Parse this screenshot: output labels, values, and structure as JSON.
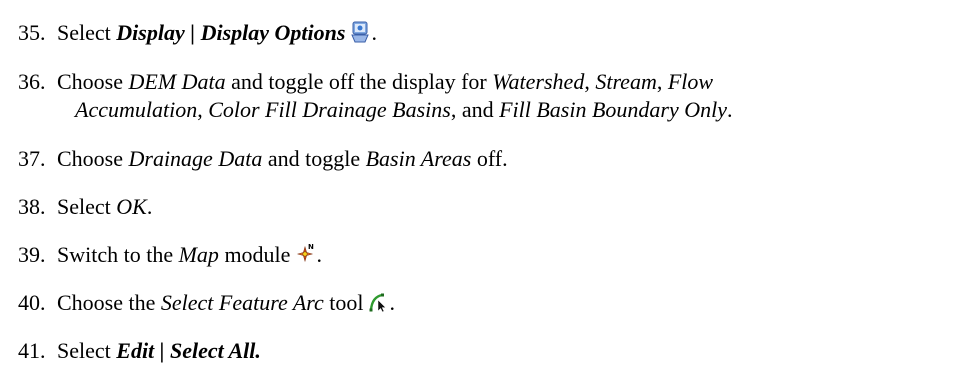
{
  "steps": [
    {
      "num": "35.",
      "t1": "Select ",
      "b1": "Display",
      "sep": " | ",
      "b2": "Display Options",
      "end": ".",
      "icon": "display-options-icon"
    },
    {
      "num": "36.",
      "t1": "Choose ",
      "i1": "DEM Data",
      "t2": " and toggle off the display for ",
      "i2": "Watershed",
      "t3": ", ",
      "i3": "Stream",
      "t4": ", ",
      "i4": "Flow",
      "i5": "Accumulation",
      "t5": ", ",
      "i6": "Color Fill Drainage Basins",
      "t6": ", and ",
      "i7": "Fill Basin Boundary Only",
      "end": "."
    },
    {
      "num": "37.",
      "t1": "Choose ",
      "i1": "Drainage Data",
      "t2": " and toggle ",
      "i2": "Basin Areas",
      "t3": " off."
    },
    {
      "num": "38.",
      "t1": "Select ",
      "i1": "OK",
      "end": "."
    },
    {
      "num": "39.",
      "t1": "Switch to the ",
      "i1": "Map",
      "t2": " module",
      "end": ".",
      "icon": "map-module-icon"
    },
    {
      "num": "40.",
      "t1": "Choose the ",
      "i1": "Select Feature Arc",
      "t2": " tool",
      "end": ".",
      "icon": "select-feature-arc-icon"
    },
    {
      "num": "41.",
      "t1": "Select ",
      "b1": "Edit",
      "sep": " | ",
      "b2": "Select All.",
      "end": ""
    }
  ]
}
